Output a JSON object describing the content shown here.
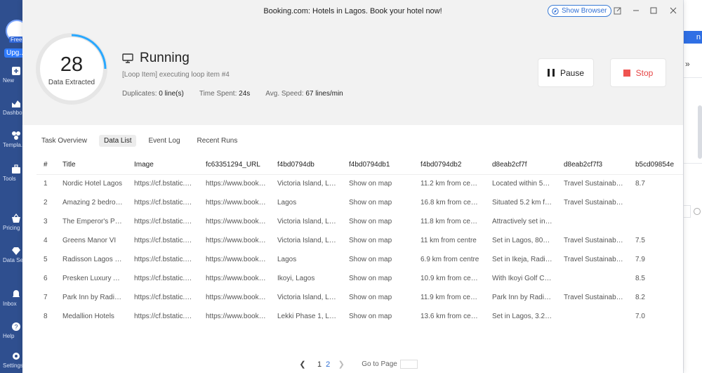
{
  "window": {
    "title": "Booking.com: Hotels in Lagos. Book your hotel now!",
    "show_browser_label": "Show Browser"
  },
  "sidebar": {
    "free_badge": "Free",
    "upgrade_label": "Upg...",
    "items": [
      {
        "label": "New",
        "icon": "plus-icon"
      },
      {
        "label": "Dashbo...",
        "icon": "dashboard-icon"
      },
      {
        "label": "Templa...",
        "icon": "templates-icon"
      },
      {
        "label": "Tools",
        "icon": "toolbox-icon"
      },
      {
        "label": "Pricing",
        "icon": "pricing-icon"
      },
      {
        "label": "Data Se...",
        "icon": "data-service-icon"
      },
      {
        "label": "Inbox",
        "icon": "inbox-icon"
      },
      {
        "label": "Help",
        "icon": "help-icon"
      },
      {
        "label": "Settings",
        "icon": "gear-icon"
      }
    ]
  },
  "run": {
    "count": "28",
    "count_label": "Data Extracted",
    "status": "Running",
    "loop_text": "[Loop Item] executing loop item #4",
    "duplicates_label": "Duplicates:",
    "duplicates_value": "0 line(s)",
    "time_label": "Time Spent:",
    "time_value": "24s",
    "speed_label": "Avg. Speed:",
    "speed_value": "67 lines/min",
    "pause_label": "Pause",
    "stop_label": "Stop"
  },
  "tabs": [
    {
      "label": "Task Overview",
      "active": false
    },
    {
      "label": "Data List",
      "active": true
    },
    {
      "label": "Event Log",
      "active": false
    },
    {
      "label": "Recent Runs",
      "active": false
    }
  ],
  "table": {
    "headers": [
      "#",
      "Title",
      "Image",
      "fc63351294_URL",
      "f4bd0794db",
      "f4bd0794db1",
      "f4bd0794db2",
      "d8eab2cf7f",
      "d8eab2cf7f3",
      "b5cd09854e"
    ],
    "rows": [
      [
        "1",
        "Nordic Hotel Lagos",
        "https://cf.bstatic.co...",
        "https://www.booki...",
        "Victoria Island, Lag...",
        "Show on map",
        "11.2 km from centre",
        "Located within 550...",
        "Travel Sustainable ...",
        "8.7"
      ],
      [
        "2",
        "Amazing 2 bedroo...",
        "https://cf.bstatic.co...",
        "https://www.booki...",
        "Lagos",
        "Show on map",
        "16.8 km from centre",
        "Situated 5.2 km fro...",
        "Travel Sustainable ...",
        ""
      ],
      [
        "3",
        "The Emperor's Plac...",
        "https://cf.bstatic.co...",
        "https://www.booki...",
        "Victoria Island, Lag...",
        "Show on map",
        "11.8 km from centre",
        "Attractively set in L...",
        "",
        ""
      ],
      [
        "4",
        "Greens Manor VI",
        "https://cf.bstatic.co...",
        "https://www.booki...",
        "Victoria Island, Lag...",
        "Show on map",
        "11 km from centre",
        "Set in Lagos, 800 ...",
        "Travel Sustainable ...",
        "7.5"
      ],
      [
        "5",
        "Radisson Lagos Ikeja",
        "https://cf.bstatic.co...",
        "https://www.booki...",
        "Lagos",
        "Show on map",
        "6.9 km from centre",
        "Set in Ikeja, Radiss...",
        "Travel Sustainable ...",
        "7.9"
      ],
      [
        "6",
        "Presken Luxury Ap...",
        "https://cf.bstatic.co...",
        "https://www.booki...",
        "Ikoyi, Lagos",
        "Show on map",
        "10.9 km from centre",
        "With Ikoyi Golf Co...",
        "",
        "8.5"
      ],
      [
        "7",
        "Park Inn by Radiss...",
        "https://cf.bstatic.co...",
        "https://www.booki...",
        "Victoria Island, Lag...",
        "Show on map",
        "11.9 km from centre",
        "Park Inn by Radiss...",
        "Travel Sustainable ...",
        "8.2"
      ],
      [
        "8",
        "Medallion Hotels",
        "https://cf.bstatic.co...",
        "https://www.booki...",
        "Lekki Phase 1, Lagos",
        "Show on map",
        "13.6 km from centre",
        "Set in Lagos, 3.2 k...",
        "",
        "7.0"
      ]
    ]
  },
  "pagination": {
    "pages": [
      "1",
      "2"
    ],
    "current": "2",
    "goto_label": "Go to Page"
  },
  "colors": {
    "accent": "#2f6fd4",
    "stop": "#ef5350",
    "ring": "#29a8ff"
  }
}
